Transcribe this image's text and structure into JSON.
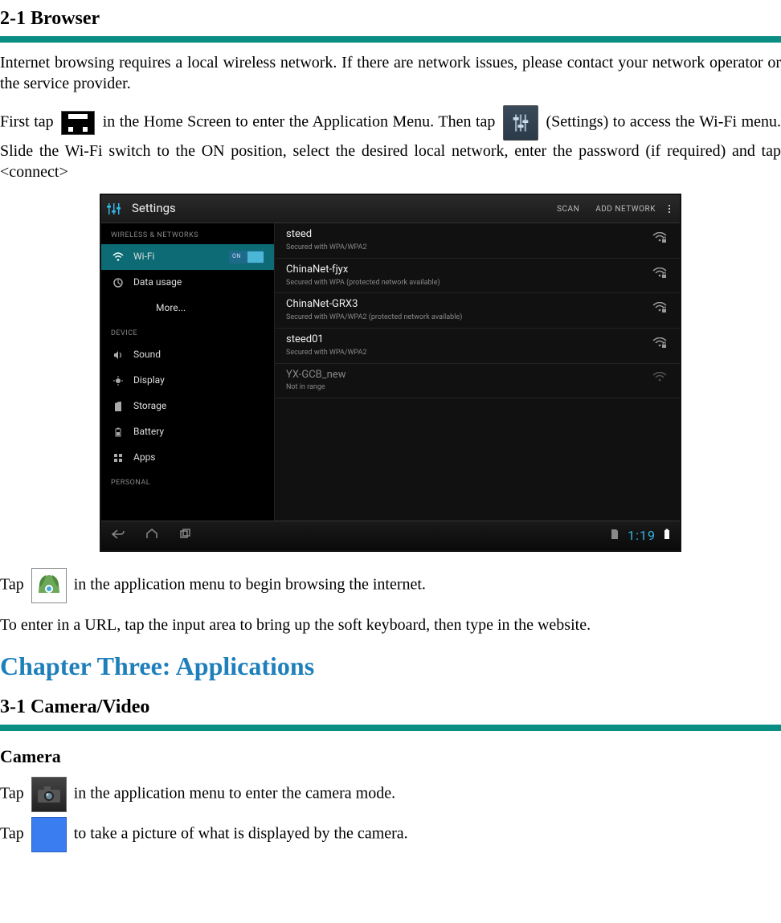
{
  "section_2_1_title": "2-1 Browser",
  "para_intro": "Internet browsing requires a local wireless network. If there are network issues, please contact your network operator or the service provider.",
  "para_first_a": "First tap ",
  "para_first_b": " in the Home Screen to enter the Application Menu.  Then tap ",
  "para_first_c": " (Settings) to access the Wi-Fi menu.  Slide the Wi-Fi switch to the ON position, select the desired local network, enter the password (if required) and tap <connect>",
  "para_tap_browser_a": "Tap ",
  "para_tap_browser_b": " in the application menu to begin browsing the internet.",
  "para_url": "To enter in a URL, tap the input area to bring up the soft keyboard, then type in the website.",
  "chapter_title": "Chapter Three: Applications",
  "section_3_1_title": "3-1 Camera/Video",
  "camera_heading": "Camera",
  "para_camera_a": "Tap ",
  "para_camera_b": " in the application menu to enter the camera mode.",
  "para_shutter_a": "Tap ",
  "para_shutter_b": " to take a picture of what is displayed by the camera.",
  "screenshot": {
    "title": "Settings",
    "scan": "SCAN",
    "add": "ADD NETWORK",
    "section_wireless": "WIRELESS & NETWORKS",
    "section_device": "DEVICE",
    "section_personal": "PERSONAL",
    "switch_label": "ON",
    "time": "1:19",
    "sidebar": [
      {
        "icon": "wifi",
        "label": "Wi-Fi",
        "active": true,
        "switch": true
      },
      {
        "icon": "circle",
        "label": "Data usage"
      },
      {
        "icon": "",
        "label": "More...",
        "indent": true
      }
    ],
    "sidebar_device": [
      {
        "icon": "speaker",
        "label": "Sound"
      },
      {
        "icon": "display",
        "label": "Display"
      },
      {
        "icon": "sd",
        "label": "Storage"
      },
      {
        "icon": "battery",
        "label": "Battery"
      },
      {
        "icon": "apps",
        "label": "Apps"
      }
    ],
    "networks": [
      {
        "name": "steed",
        "sub": "Secured with WPA/WPA2",
        "locked": true
      },
      {
        "name": "ChinaNet-fjyx",
        "sub": "Secured with WPA (protected network available)",
        "locked": true
      },
      {
        "name": "ChinaNet-GRX3",
        "sub": "Secured with WPA/WPA2 (protected network available)",
        "locked": true
      },
      {
        "name": "steed01",
        "sub": "Secured with WPA/WPA2",
        "locked": true
      },
      {
        "name": "YX-GCB_new",
        "sub": "Not in range",
        "locked": false
      }
    ]
  }
}
